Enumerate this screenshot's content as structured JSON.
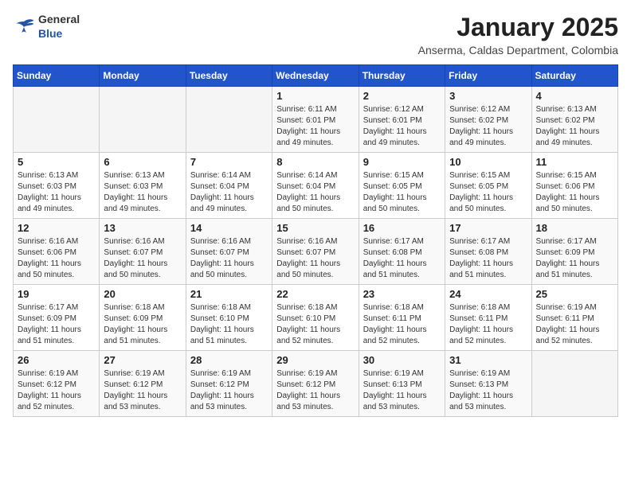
{
  "header": {
    "logo": {
      "general": "General",
      "blue": "Blue"
    },
    "month": "January 2025",
    "location": "Anserma, Caldas Department, Colombia"
  },
  "weekdays": [
    "Sunday",
    "Monday",
    "Tuesday",
    "Wednesday",
    "Thursday",
    "Friday",
    "Saturday"
  ],
  "weeks": [
    [
      {
        "day": "",
        "sunrise": "",
        "sunset": "",
        "daylight": ""
      },
      {
        "day": "",
        "sunrise": "",
        "sunset": "",
        "daylight": ""
      },
      {
        "day": "",
        "sunrise": "",
        "sunset": "",
        "daylight": ""
      },
      {
        "day": "1",
        "sunrise": "Sunrise: 6:11 AM",
        "sunset": "Sunset: 6:01 PM",
        "daylight": "Daylight: 11 hours and 49 minutes."
      },
      {
        "day": "2",
        "sunrise": "Sunrise: 6:12 AM",
        "sunset": "Sunset: 6:01 PM",
        "daylight": "Daylight: 11 hours and 49 minutes."
      },
      {
        "day": "3",
        "sunrise": "Sunrise: 6:12 AM",
        "sunset": "Sunset: 6:02 PM",
        "daylight": "Daylight: 11 hours and 49 minutes."
      },
      {
        "day": "4",
        "sunrise": "Sunrise: 6:13 AM",
        "sunset": "Sunset: 6:02 PM",
        "daylight": "Daylight: 11 hours and 49 minutes."
      }
    ],
    [
      {
        "day": "5",
        "sunrise": "Sunrise: 6:13 AM",
        "sunset": "Sunset: 6:03 PM",
        "daylight": "Daylight: 11 hours and 49 minutes."
      },
      {
        "day": "6",
        "sunrise": "Sunrise: 6:13 AM",
        "sunset": "Sunset: 6:03 PM",
        "daylight": "Daylight: 11 hours and 49 minutes."
      },
      {
        "day": "7",
        "sunrise": "Sunrise: 6:14 AM",
        "sunset": "Sunset: 6:04 PM",
        "daylight": "Daylight: 11 hours and 49 minutes."
      },
      {
        "day": "8",
        "sunrise": "Sunrise: 6:14 AM",
        "sunset": "Sunset: 6:04 PM",
        "daylight": "Daylight: 11 hours and 50 minutes."
      },
      {
        "day": "9",
        "sunrise": "Sunrise: 6:15 AM",
        "sunset": "Sunset: 6:05 PM",
        "daylight": "Daylight: 11 hours and 50 minutes."
      },
      {
        "day": "10",
        "sunrise": "Sunrise: 6:15 AM",
        "sunset": "Sunset: 6:05 PM",
        "daylight": "Daylight: 11 hours and 50 minutes."
      },
      {
        "day": "11",
        "sunrise": "Sunrise: 6:15 AM",
        "sunset": "Sunset: 6:06 PM",
        "daylight": "Daylight: 11 hours and 50 minutes."
      }
    ],
    [
      {
        "day": "12",
        "sunrise": "Sunrise: 6:16 AM",
        "sunset": "Sunset: 6:06 PM",
        "daylight": "Daylight: 11 hours and 50 minutes."
      },
      {
        "day": "13",
        "sunrise": "Sunrise: 6:16 AM",
        "sunset": "Sunset: 6:07 PM",
        "daylight": "Daylight: 11 hours and 50 minutes."
      },
      {
        "day": "14",
        "sunrise": "Sunrise: 6:16 AM",
        "sunset": "Sunset: 6:07 PM",
        "daylight": "Daylight: 11 hours and 50 minutes."
      },
      {
        "day": "15",
        "sunrise": "Sunrise: 6:16 AM",
        "sunset": "Sunset: 6:07 PM",
        "daylight": "Daylight: 11 hours and 50 minutes."
      },
      {
        "day": "16",
        "sunrise": "Sunrise: 6:17 AM",
        "sunset": "Sunset: 6:08 PM",
        "daylight": "Daylight: 11 hours and 51 minutes."
      },
      {
        "day": "17",
        "sunrise": "Sunrise: 6:17 AM",
        "sunset": "Sunset: 6:08 PM",
        "daylight": "Daylight: 11 hours and 51 minutes."
      },
      {
        "day": "18",
        "sunrise": "Sunrise: 6:17 AM",
        "sunset": "Sunset: 6:09 PM",
        "daylight": "Daylight: 11 hours and 51 minutes."
      }
    ],
    [
      {
        "day": "19",
        "sunrise": "Sunrise: 6:17 AM",
        "sunset": "Sunset: 6:09 PM",
        "daylight": "Daylight: 11 hours and 51 minutes."
      },
      {
        "day": "20",
        "sunrise": "Sunrise: 6:18 AM",
        "sunset": "Sunset: 6:09 PM",
        "daylight": "Daylight: 11 hours and 51 minutes."
      },
      {
        "day": "21",
        "sunrise": "Sunrise: 6:18 AM",
        "sunset": "Sunset: 6:10 PM",
        "daylight": "Daylight: 11 hours and 51 minutes."
      },
      {
        "day": "22",
        "sunrise": "Sunrise: 6:18 AM",
        "sunset": "Sunset: 6:10 PM",
        "daylight": "Daylight: 11 hours and 52 minutes."
      },
      {
        "day": "23",
        "sunrise": "Sunrise: 6:18 AM",
        "sunset": "Sunset: 6:11 PM",
        "daylight": "Daylight: 11 hours and 52 minutes."
      },
      {
        "day": "24",
        "sunrise": "Sunrise: 6:18 AM",
        "sunset": "Sunset: 6:11 PM",
        "daylight": "Daylight: 11 hours and 52 minutes."
      },
      {
        "day": "25",
        "sunrise": "Sunrise: 6:19 AM",
        "sunset": "Sunset: 6:11 PM",
        "daylight": "Daylight: 11 hours and 52 minutes."
      }
    ],
    [
      {
        "day": "26",
        "sunrise": "Sunrise: 6:19 AM",
        "sunset": "Sunset: 6:12 PM",
        "daylight": "Daylight: 11 hours and 52 minutes."
      },
      {
        "day": "27",
        "sunrise": "Sunrise: 6:19 AM",
        "sunset": "Sunset: 6:12 PM",
        "daylight": "Daylight: 11 hours and 53 minutes."
      },
      {
        "day": "28",
        "sunrise": "Sunrise: 6:19 AM",
        "sunset": "Sunset: 6:12 PM",
        "daylight": "Daylight: 11 hours and 53 minutes."
      },
      {
        "day": "29",
        "sunrise": "Sunrise: 6:19 AM",
        "sunset": "Sunset: 6:12 PM",
        "daylight": "Daylight: 11 hours and 53 minutes."
      },
      {
        "day": "30",
        "sunrise": "Sunrise: 6:19 AM",
        "sunset": "Sunset: 6:13 PM",
        "daylight": "Daylight: 11 hours and 53 minutes."
      },
      {
        "day": "31",
        "sunrise": "Sunrise: 6:19 AM",
        "sunset": "Sunset: 6:13 PM",
        "daylight": "Daylight: 11 hours and 53 minutes."
      },
      {
        "day": "",
        "sunrise": "",
        "sunset": "",
        "daylight": ""
      }
    ]
  ]
}
